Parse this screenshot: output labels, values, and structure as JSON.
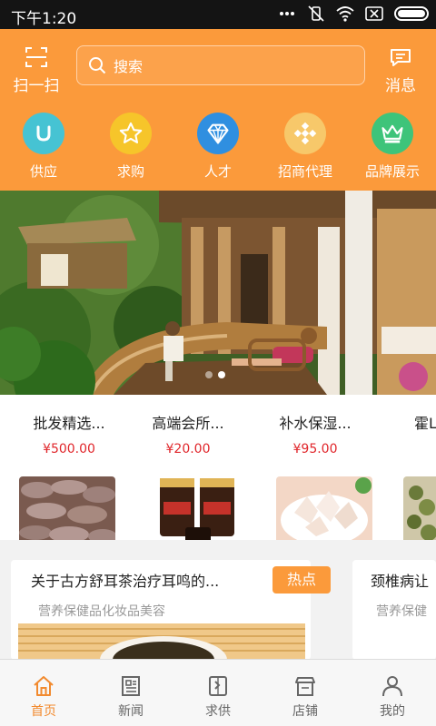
{
  "status_bar": {
    "time": "下午1:20"
  },
  "header": {
    "scan_label": "扫一扫",
    "search_placeholder": "搜索",
    "message_label": "消息"
  },
  "categories": [
    {
      "label": "供应",
      "icon": "supply-u-icon",
      "color": "#46c3d3"
    },
    {
      "label": "求购",
      "icon": "star-icon",
      "color": "#f6c52a"
    },
    {
      "label": "人才",
      "icon": "diamond-icon",
      "color": "#2f8fe0"
    },
    {
      "label": "招商代理",
      "icon": "cross-dots-icon",
      "color": "#f7c86a"
    },
    {
      "label": "品牌展示",
      "icon": "crown-icon",
      "color": "#3ec47a"
    }
  ],
  "banner": {
    "slide_count": 2,
    "active_slide": 1
  },
  "products": [
    {
      "name": "批发精选...",
      "price": "¥500.00"
    },
    {
      "name": "高端会所...",
      "price": "¥20.00"
    },
    {
      "name": "补水保湿...",
      "price": "¥95.00"
    },
    {
      "name": "霍L",
      "price": ""
    }
  ],
  "news": [
    {
      "title": "关于古方舒耳茶治疗耳鸣的...",
      "category": "营养保健品化妆品美容",
      "badge": "热点"
    },
    {
      "title": "颈椎病让",
      "category": "营养保健"
    }
  ],
  "bottom_nav": [
    {
      "label": "首页",
      "icon": "home-icon",
      "active": true
    },
    {
      "label": "新闻",
      "icon": "news-icon",
      "active": false
    },
    {
      "label": "求供",
      "icon": "supply-demand-icon",
      "active": false
    },
    {
      "label": "店铺",
      "icon": "store-icon",
      "active": false
    },
    {
      "label": "我的",
      "icon": "user-icon",
      "active": false
    }
  ],
  "colors": {
    "brand": "#fb9a3b",
    "price": "#e0262b",
    "nav_active": "#f28a2e"
  }
}
